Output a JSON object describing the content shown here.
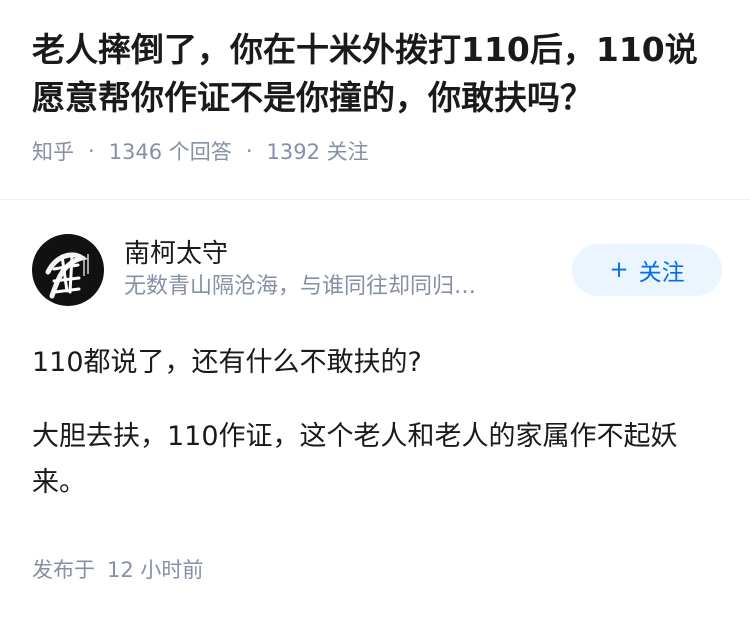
{
  "question": {
    "title": "老人摔倒了，你在十米外拨打110后，110说愿意帮你作证不是你撞的，你敢扶吗？",
    "source": "知乎",
    "answer_count": "1346 个回答",
    "follower_count": "1392 关注"
  },
  "answer": {
    "author_name": "南柯太守",
    "author_bio": "无数青山隔沧海，与谁同往却同归…",
    "avatar_text": "崔",
    "follow_button": "关注",
    "follow_plus": "+",
    "paragraphs": [
      "110都说了，还有什么不敢扶的?",
      "大胆去扶，110作证，这个老人和老人的家属作不起妖来。"
    ],
    "time_prefix": "发布于",
    "time_value": "12 小时前"
  },
  "colors": {
    "accent": "#056de8",
    "accent_bg": "#ebf5ff",
    "muted": "#8590a6",
    "text": "#1a1a1a"
  }
}
